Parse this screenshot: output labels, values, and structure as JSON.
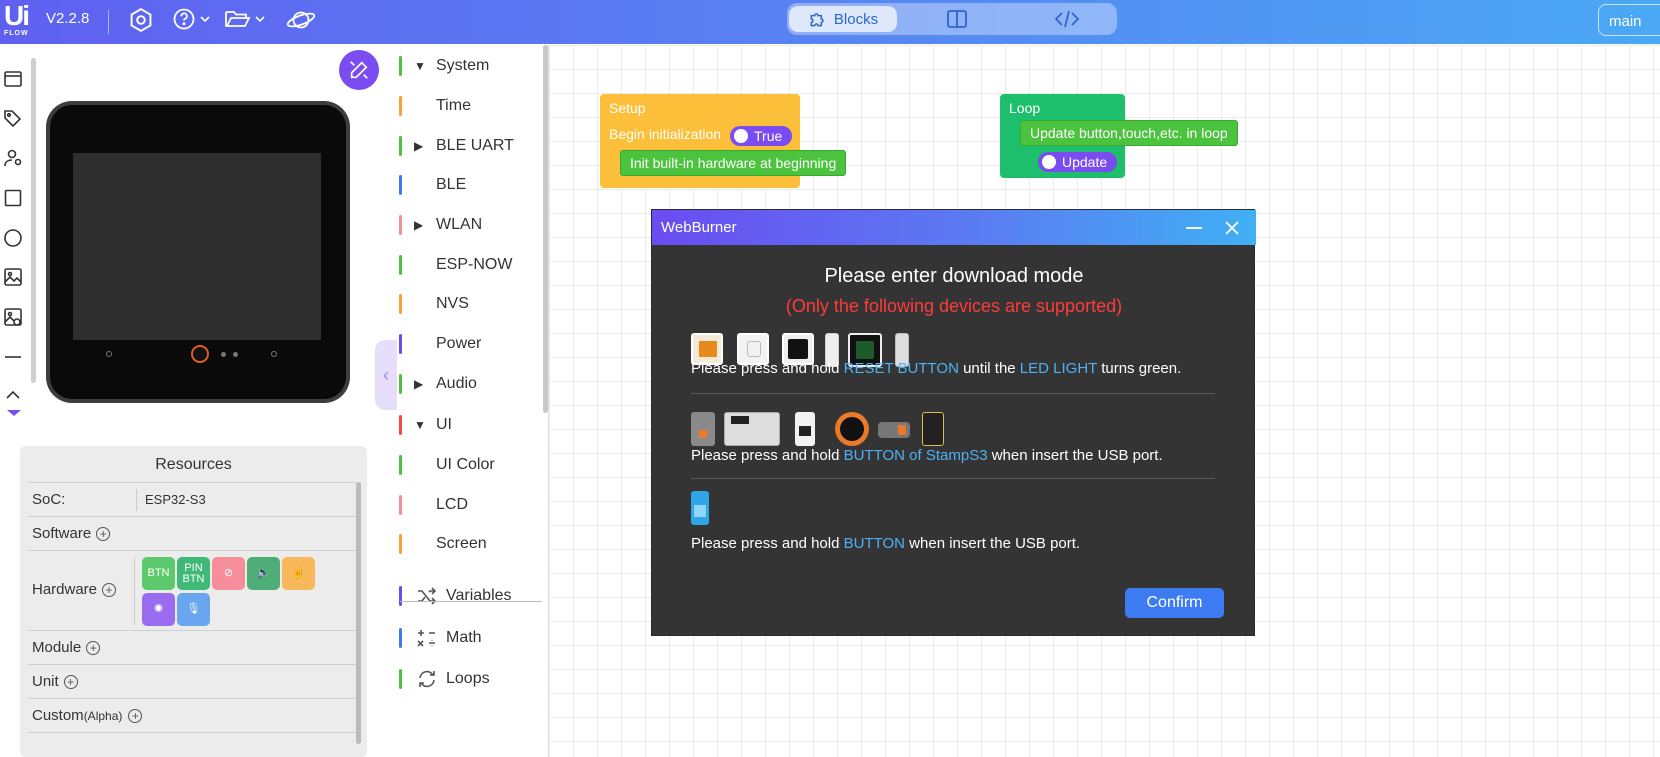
{
  "topbar": {
    "logo_big": "Ui",
    "logo_small": "FLOW",
    "version": "V2.2.8",
    "icons": [
      "settings-icon",
      "help-icon",
      "folder-icon",
      "planet-icon"
    ],
    "modes": {
      "blocks": "Blocks",
      "split_icon": "split-view-icon",
      "code_icon": "code-icon"
    },
    "branch": "main",
    "gradient": [
      "#5f60f0",
      "#4aa8f4"
    ]
  },
  "toolstrip": [
    "window-icon",
    "tag-icon",
    "person-icon",
    "square-icon",
    "circle-icon",
    "image-icon",
    "image-stack-icon",
    "line-icon",
    "chevron-up-icon"
  ],
  "resources": {
    "title": "Resources",
    "soc_label": "SoC:",
    "soc_value": "ESP32-S3",
    "software": "Software",
    "hardware": "Hardware",
    "hardware_items": [
      {
        "label": "BTN",
        "color": "#5cc96c"
      },
      {
        "label": "PIN\nBTN",
        "color": "#3fb878"
      },
      {
        "label": "",
        "icon": "speed-icon",
        "color": "#f58d9a"
      },
      {
        "label": "",
        "icon": "speaker-icon",
        "color": "#4fae78"
      },
      {
        "label": "",
        "icon": "touch-icon",
        "color": "#f7b85b"
      },
      {
        "label": "",
        "icon": "light-icon",
        "color": "#9a6cf0"
      },
      {
        "label": "",
        "icon": "mic-icon",
        "color": "#6aa5f0"
      }
    ],
    "module": "Module",
    "unit": "Unit",
    "custom": "Custom",
    "custom_suffix": "(Alpha)"
  },
  "categories": [
    {
      "label": "System",
      "color": "#4cc33f",
      "arrow": "down"
    },
    {
      "label": "Time",
      "color": "#f5a23a",
      "arrow": ""
    },
    {
      "label": "BLE UART",
      "color": "#4cc33f",
      "arrow": "right"
    },
    {
      "label": "BLE",
      "color": "#3d7bf2",
      "arrow": ""
    },
    {
      "label": "WLAN",
      "color": "#f58d9a",
      "arrow": "right"
    },
    {
      "label": "ESP-NOW",
      "color": "#4cc33f",
      "arrow": ""
    },
    {
      "label": "NVS",
      "color": "#f5a23a",
      "arrow": ""
    },
    {
      "label": "Power",
      "color": "#6a4cf0",
      "arrow": ""
    },
    {
      "label": "Audio",
      "color": "#4cc33f",
      "arrow": "right"
    },
    {
      "label": "UI",
      "color": "#f04848",
      "arrow": "down"
    },
    {
      "label": "UI Color",
      "color": "#4cc33f",
      "arrow": ""
    },
    {
      "label": "LCD",
      "color": "#f58d9a",
      "arrow": ""
    },
    {
      "label": "Screen",
      "color": "#f5a23a",
      "arrow": ""
    },
    {
      "label": "Variables",
      "color": "#6a4cf0",
      "icon": "shuffle-icon"
    },
    {
      "label": "Math",
      "color": "#3d7bf2",
      "icon": "math-icon"
    },
    {
      "label": "Loops",
      "color": "#4cc33f",
      "icon": "loop-icon"
    }
  ],
  "workspace": {
    "setup": {
      "title": "Setup",
      "line": "Begin initialization",
      "toggle": "True",
      "inner": "Init built-in hardware at beginning"
    },
    "loop": {
      "title": "Loop",
      "inner": "Update button,touch,etc. in loop",
      "toggle": "Update"
    }
  },
  "dialog": {
    "title": "WebBurner",
    "heading": "Please enter download mode",
    "subheading": "(Only the following devices are supported)",
    "step1": {
      "pre": "Please press and hold ",
      "hl1": "RESET BUTTON",
      "mid": " until the ",
      "hl2": "LED LIGHT",
      "post": " turns green."
    },
    "step2": {
      "pre": "Please press and hold ",
      "hl1": "BUTTON of StampS3",
      "post": " when insert the USB port."
    },
    "step3": {
      "pre": "Please press and hold ",
      "hl1": "BUTTON",
      "post": " when insert the USB port."
    },
    "confirm": "Confirm",
    "highlight_color": "#4fb1f5",
    "warning_color": "#ff3b3b"
  }
}
